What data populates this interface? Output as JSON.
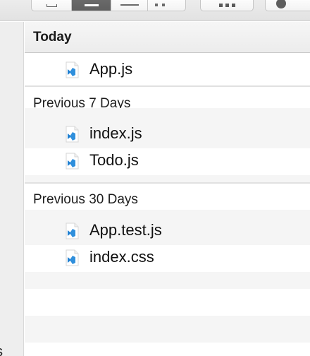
{
  "window": {
    "sidebar_fragment": "s"
  },
  "list": {
    "column_title": "Today",
    "groups": [
      {
        "label": "Today",
        "files": [
          {
            "name": "App.js",
            "icon": "vscode-file-icon"
          }
        ]
      },
      {
        "label": "Previous 7 Days",
        "files": [
          {
            "name": "index.js",
            "icon": "vscode-file-icon"
          },
          {
            "name": "Todo.js",
            "icon": "vscode-file-icon"
          }
        ]
      },
      {
        "label": "Previous 30 Days",
        "files": [
          {
            "name": "App.test.js",
            "icon": "vscode-file-icon"
          },
          {
            "name": "index.css",
            "icon": "vscode-file-icon"
          }
        ]
      }
    ]
  },
  "colors": {
    "stripe": "#f5f5f5",
    "icon_blue": "#1f7fd1",
    "selected_segment": "#5e5e5e"
  }
}
